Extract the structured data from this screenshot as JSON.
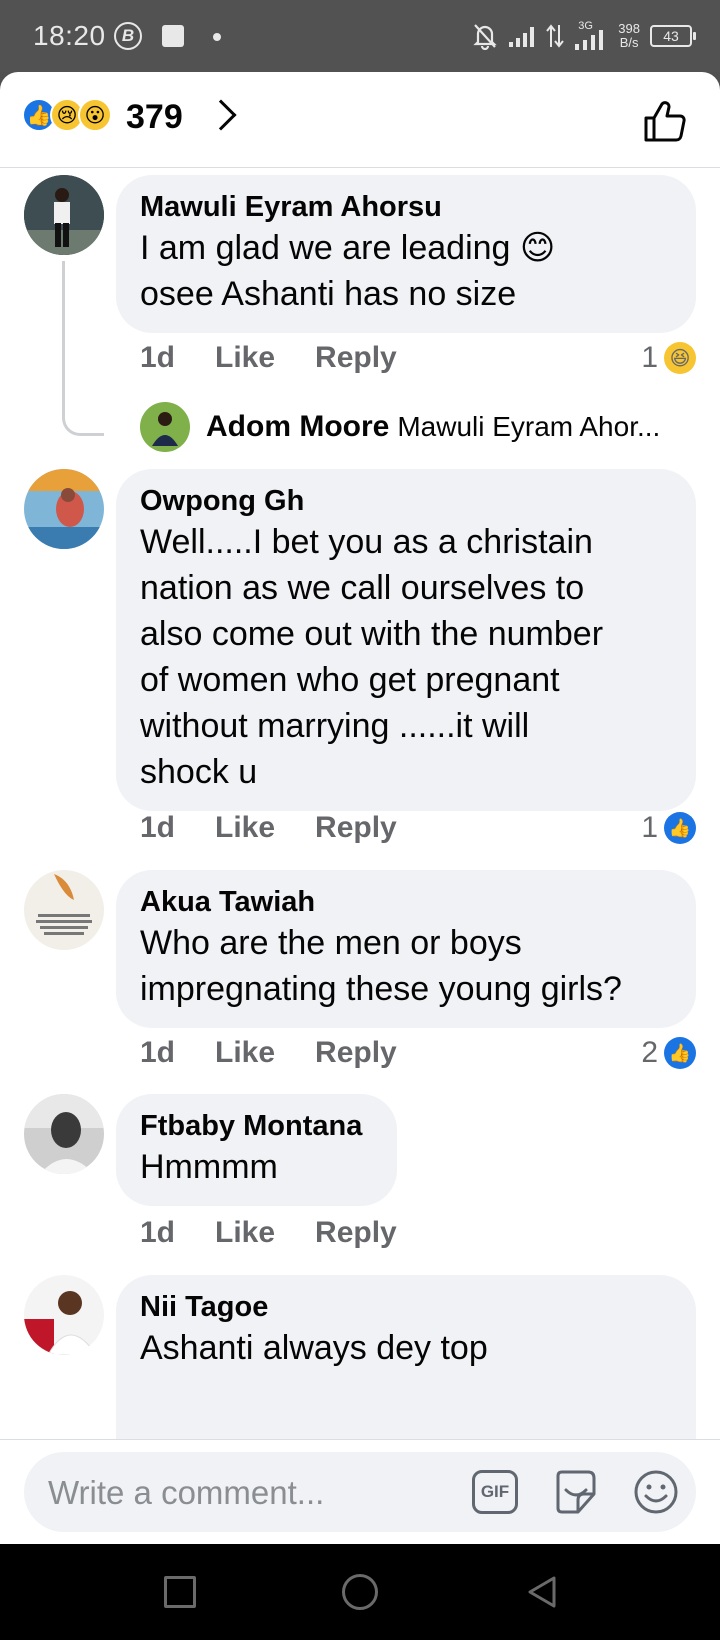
{
  "status_bar": {
    "time": "18:20",
    "b_badge": "B",
    "net_speed_value": "398",
    "net_speed_unit": "B/s",
    "network_label": "3G",
    "battery": "43"
  },
  "reactions": {
    "count": "379",
    "emojis": [
      "👍",
      "😢",
      "😮"
    ]
  },
  "comments": [
    {
      "author": "Mawuli Eyram Ahorsu",
      "lines": [
        "I am glad we are leading 😊",
        "osee Ashanti has no size"
      ],
      "time": "1d",
      "like_label": "Like",
      "reply_label": "Reply",
      "reaction_count": "1",
      "reaction_emoji": "😆",
      "reply_preview": {
        "author": "Adom Moore",
        "snippet": "Mawuli Eyram Ahor..."
      }
    },
    {
      "author": "Owpong Gh",
      "lines": [
        "Well.....I bet you as a christain",
        "nation as we call ourselves to",
        "also come out with the number",
        "of women who get pregnant",
        "without marrying ......it will",
        "shock u"
      ],
      "time": "1d",
      "like_label": "Like",
      "reply_label": "Reply",
      "reaction_count": "1",
      "reaction_emoji": "👍"
    },
    {
      "author": "Akua Tawiah",
      "lines": [
        "Who are the men or boys",
        "impregnating these young girls?"
      ],
      "time": "1d",
      "like_label": "Like",
      "reply_label": "Reply",
      "reaction_count": "2",
      "reaction_emoji": "👍"
    },
    {
      "author": "Ftbaby Montana",
      "lines": [
        "Hmmmm"
      ],
      "time": "1d",
      "like_label": "Like",
      "reply_label": "Reply"
    },
    {
      "author": "Nii Tagoe",
      "lines": [
        "Ashanti always dey top"
      ]
    }
  ],
  "composer": {
    "placeholder": "Write a comment...",
    "gif_label": "GIF"
  },
  "colors": {
    "accent": "#1b74e4",
    "bubble": "#f0f2f5",
    "meta_text": "#65676b"
  }
}
